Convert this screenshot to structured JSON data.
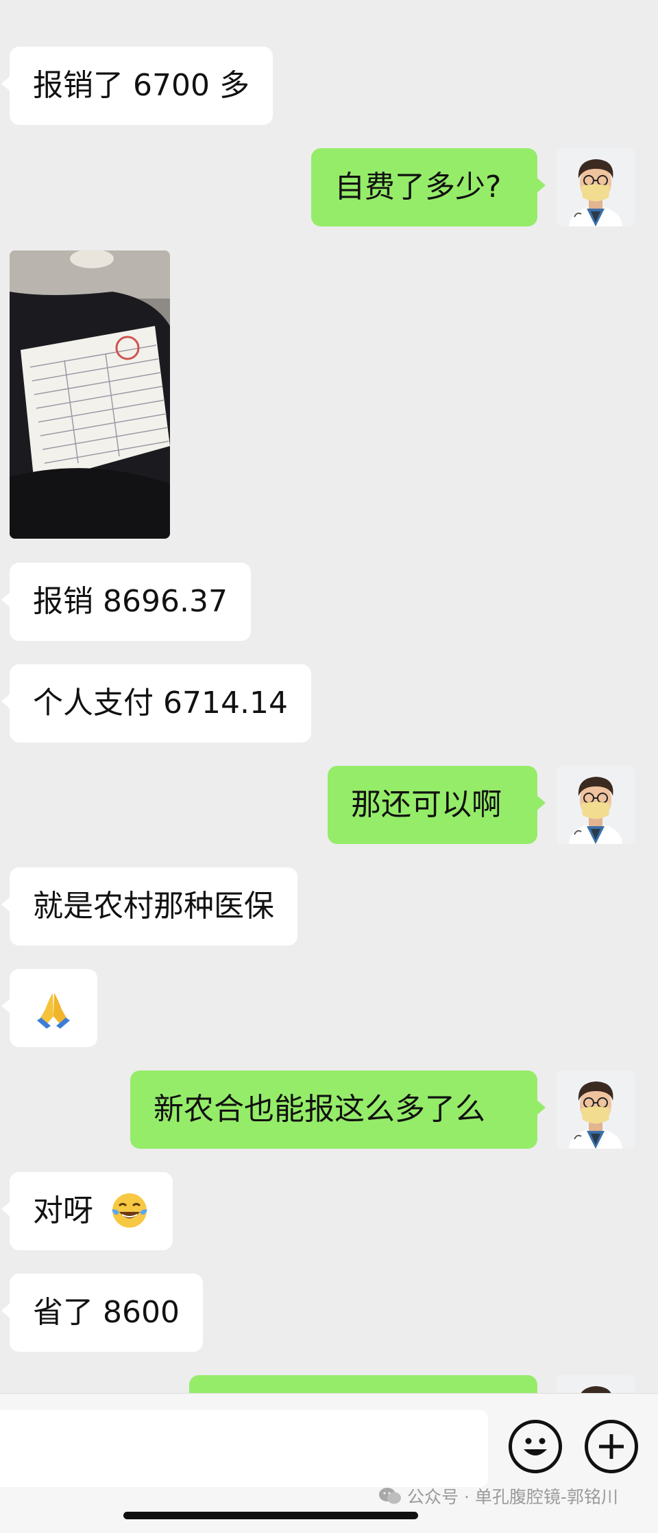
{
  "messages": [
    {
      "text": "报销了 6700 多"
    },
    {
      "text": "自费了多少?"
    },
    {
      "text": "报销 8696.37"
    },
    {
      "text": "个人支付 6714.14"
    },
    {
      "text": "那还可以啊"
    },
    {
      "text": "就是农村那种医保"
    },
    {
      "text": "新农合也能报这么多了么"
    },
    {
      "text": "对呀"
    },
    {
      "text": "省了 8600"
    }
  ],
  "icons": {
    "pray": "folded-hands-emoji",
    "laugh": "tears-of-joy-emoji",
    "emoji_button": "smiley-icon",
    "plus_button": "plus-icon"
  },
  "footer": {
    "watermark": "公众号 · 单孔腹腔镜-郭铭川"
  },
  "colors": {
    "background": "#ededed",
    "outgoing_bubble": "#95ec69",
    "incoming_bubble": "#ffffff"
  }
}
